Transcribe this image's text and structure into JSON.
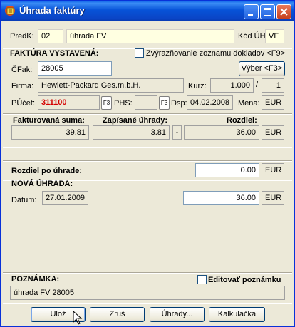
{
  "window": {
    "title": "Úhrada faktúry"
  },
  "header": {
    "predk_label": "PredK:",
    "predk_value": "02",
    "predk_name": "úhrada FV",
    "kod_uh_label": "Kód ÚH:",
    "kod_uh_value": "VF"
  },
  "faktura": {
    "section_label": "FAKTÚRA VYSTAVENÁ:",
    "highlight_label": "Zvýrazňovanie zoznamu dokladov <F9>",
    "cfak_label": "ČFak:",
    "cfak_value": "28005",
    "vyber_button": "Výber <F3>",
    "firma_label": "Firma:",
    "firma_value": "Hewlett-Packard Ges.m.b.H.",
    "kurz_label": "Kurz:",
    "kurz_value": "1.000",
    "kurz_slash": "/",
    "kurz_value2": "1",
    "pucet_label": "PÚčet:",
    "pucet_value": "311100",
    "f3": "F3",
    "phs_label": "PHS:",
    "dsp_label": "Dsp:",
    "dsp_value": "04.02.2008",
    "mena_label": "Mena:",
    "mena_value": "EUR"
  },
  "summary": {
    "fakt_suma_label": "Fakturovaná suma:",
    "fakt_suma_value": "39.81",
    "zapisane_label": "Zapísané úhrady:",
    "zapisane_value": "3.81",
    "minus": "-",
    "rozdiel_label": "Rozdiel:",
    "rozdiel_value": "36.00",
    "currency": "EUR"
  },
  "after": {
    "rozdiel_po_label": "Rozdiel po úhrade:",
    "rozdiel_po_value": "0.00",
    "currency": "EUR"
  },
  "nova": {
    "section_label": "NOVÁ ÚHRADA:",
    "datum_label": "Dátum:",
    "datum_value": "27.01.2009",
    "amount_value": "36.00",
    "currency": "EUR"
  },
  "note": {
    "section_label": "POZNÁMKA:",
    "edit_label": "Editovať poznámku",
    "value": "úhrada FV 28005"
  },
  "buttons": {
    "save": "Ulož",
    "cancel": "Zruš",
    "payments": "Úhrady...",
    "calc": "Kalkulačka"
  },
  "colors": {
    "accent_red": "#d40000",
    "titlebar": "#0753d8"
  }
}
